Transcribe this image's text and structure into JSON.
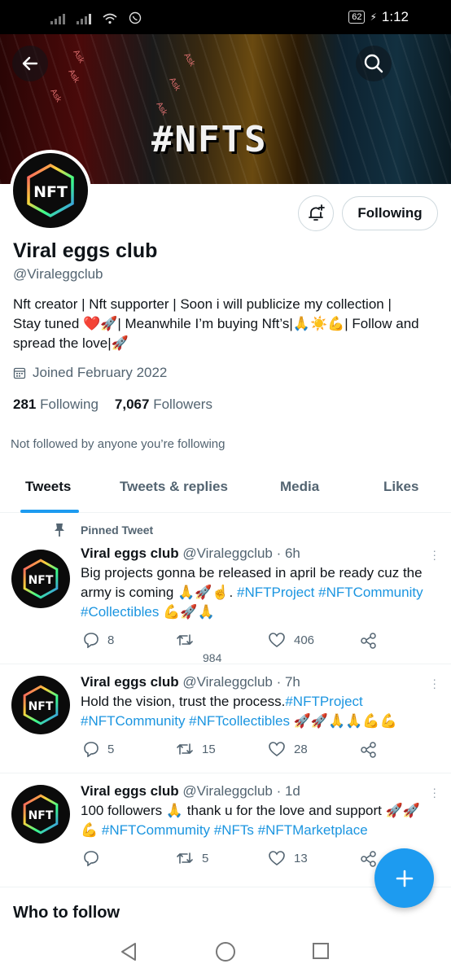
{
  "status_bar": {
    "battery": "62",
    "time": "1:12"
  },
  "banner": {
    "hero_text": "#NFTS",
    "ticker_word": "Ask"
  },
  "profile": {
    "name": "Viral eggs club",
    "handle": "@Viraleggclub",
    "bio_line1": "Nft creator | Nft supporter | Soon i will publicize my collection |",
    "bio_line2": "Stay tuned ❤️🚀| Meanwhile I’m buying Nft’s|🙏☀️💪| Follow and",
    "bio_line3": "spread the love|🚀",
    "joined": "Joined February 2022",
    "following_count": "281",
    "following_label": "Following",
    "followers_count": "7,067",
    "followers_label": "Followers",
    "not_followed": "Not followed by anyone you’re following",
    "follow_button": "Following",
    "avatar_text": "NFT"
  },
  "tabs": [
    "Tweets",
    "Tweets & replies",
    "Media",
    "Likes"
  ],
  "tweets": [
    {
      "pinned_label": "Pinned Tweet",
      "name": "Viral eggs club",
      "meta": "@Viraleggclub · 6h",
      "line1": "Big projects gonna be released in april be ready cuz the",
      "line2_text": "army is coming 🙏🚀☝️. ",
      "line2_tags": "#NFTProject #NFTCommunity",
      "line3_tags": "#Collectibles",
      "line3_text": " 💪🚀🙏",
      "replies": "8",
      "retweets": "984",
      "likes": "406"
    },
    {
      "name": "Viral eggs club",
      "meta": "@Viraleggclub · 7h",
      "line1_text": "Hold the vision, trust the process.",
      "line1_tags": "#NFTProject",
      "line2_tags": "#NFTCommunity #NFTcollectibles",
      "line2_text": " 🚀🚀🙏🙏💪💪",
      "replies": "5",
      "retweets": "15",
      "likes": "28"
    },
    {
      "name": "Viral eggs club",
      "meta": "@Viraleggclub · 1d",
      "line1_text": "100 followers 🙏 thank u for the love and support 🚀🚀",
      "line2_text": "💪 ",
      "line2_tags": "#NFTCommumity #NFTs #NFTMarketplace",
      "replies": "",
      "retweets": "5",
      "likes": "13"
    }
  ],
  "who_to_follow": "Who to follow",
  "colors": {
    "accent": "#1d9bf0",
    "link": "#1b95e0",
    "secondary_text": "#536471"
  }
}
